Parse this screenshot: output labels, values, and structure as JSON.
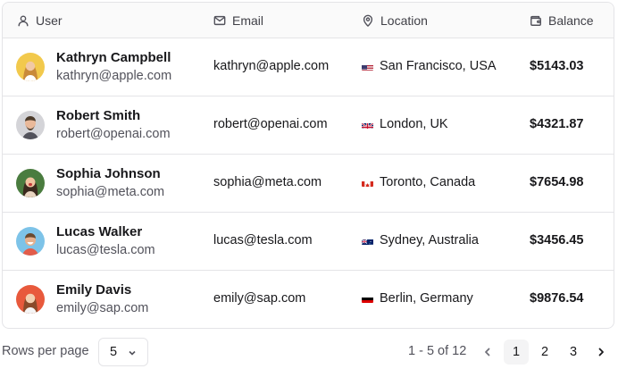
{
  "columns": {
    "user": "User",
    "email": "Email",
    "location": "Location",
    "balance": "Balance"
  },
  "rows": [
    {
      "name": "Kathryn Campbell",
      "email": "kathryn@apple.com",
      "location": "San Francisco, USA",
      "country": "us",
      "balance": "$5143.03",
      "avatar_bg": "#f2c94c"
    },
    {
      "name": "Robert Smith",
      "email": "robert@openai.com",
      "location": "London, UK",
      "country": "gb",
      "balance": "$4321.87",
      "avatar_bg": "#d4d4d8"
    },
    {
      "name": "Sophia Johnson",
      "email": "sophia@meta.com",
      "location": "Toronto, Canada",
      "country": "ca",
      "balance": "$7654.98",
      "avatar_bg": "#4a7c3f"
    },
    {
      "name": "Lucas Walker",
      "email": "lucas@tesla.com",
      "location": "Sydney, Australia",
      "country": "au",
      "balance": "$3456.45",
      "avatar_bg": "#7dc3e8"
    },
    {
      "name": "Emily Davis",
      "email": "emily@sap.com",
      "location": "Berlin, Germany",
      "country": "de",
      "balance": "$9876.54",
      "avatar_bg": "#e8593c"
    }
  ],
  "pagination": {
    "rows_per_page_label": "Rows per page",
    "rows_per_page_value": "5",
    "range_text": "1 - 5 of 12",
    "pages": [
      "1",
      "2",
      "3"
    ],
    "current_page": "1"
  }
}
